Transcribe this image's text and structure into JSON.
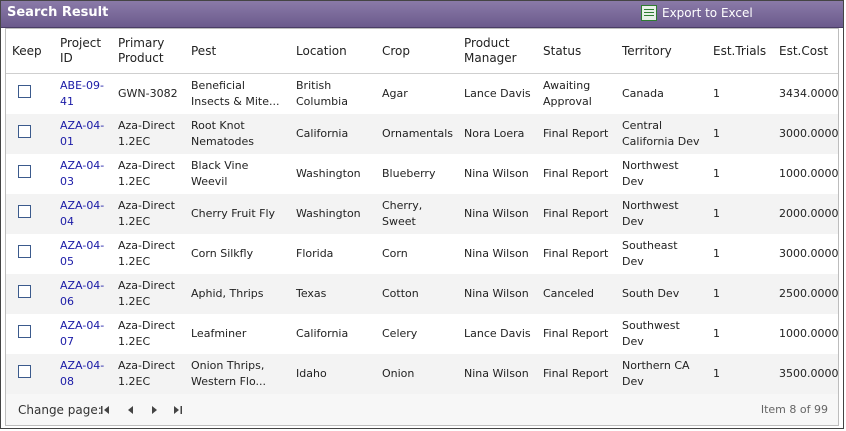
{
  "window": {
    "title": "Search Result",
    "export_label": "Export to Excel"
  },
  "columns": [
    "Keep",
    "Project ID",
    "Primary Product",
    "Pest",
    "Location",
    "Crop",
    "Product Manager",
    "Status",
    "Territory",
    "Est.Trials",
    "Est.Cost"
  ],
  "rows": [
    {
      "project_id": "ABE-09-41",
      "product": "GWN-3082",
      "pest": "Beneficial Insects & Mite...",
      "location": "British Columbia",
      "crop": "Agar",
      "manager": "Lance Davis",
      "status": "Awaiting Approval",
      "territory": "Canada",
      "trials": "1",
      "cost": "3434.0000"
    },
    {
      "project_id": "AZA-04-01",
      "product": "Aza-Direct 1.2EC",
      "pest": "Root Knot Nematodes",
      "location": "California",
      "crop": "Ornamentals",
      "manager": "Nora Loera",
      "status": "Final Report",
      "territory": "Central California Dev",
      "trials": "1",
      "cost": "3000.0000"
    },
    {
      "project_id": "AZA-04-03",
      "product": "Aza-Direct 1.2EC",
      "pest": "Black Vine Weevil",
      "location": "Washington",
      "crop": "Blueberry",
      "manager": "Nina Wilson",
      "status": "Final Report",
      "territory": "Northwest Dev",
      "trials": "1",
      "cost": "1000.0000"
    },
    {
      "project_id": "AZA-04-04",
      "product": "Aza-Direct 1.2EC",
      "pest": "Cherry Fruit Fly",
      "location": "Washington",
      "crop": "Cherry, Sweet",
      "manager": "Nina Wilson",
      "status": "Final Report",
      "territory": "Northwest Dev",
      "trials": "1",
      "cost": "2000.0000"
    },
    {
      "project_id": "AZA-04-05",
      "product": "Aza-Direct 1.2EC",
      "pest": "Corn Silkfly",
      "location": "Florida",
      "crop": "Corn",
      "manager": "Nina Wilson",
      "status": "Final Report",
      "territory": "Southeast Dev",
      "trials": "1",
      "cost": "3000.0000"
    },
    {
      "project_id": "AZA-04-06",
      "product": "Aza-Direct 1.2EC",
      "pest": "Aphid, Thrips",
      "location": "Texas",
      "crop": "Cotton",
      "manager": "Nina Wilson",
      "status": "Canceled",
      "territory": "South Dev",
      "trials": "1",
      "cost": "2500.0000"
    },
    {
      "project_id": "AZA-04-07",
      "product": "Aza-Direct 1.2EC",
      "pest": "Leafminer",
      "location": "California",
      "crop": "Celery",
      "manager": "Lance Davis",
      "status": "Final Report",
      "territory": "Southwest Dev",
      "trials": "1",
      "cost": "1000.0000"
    },
    {
      "project_id": "AZA-04-08",
      "product": "Aza-Direct 1.2EC",
      "pest": "Onion Thrips, Western Flo...",
      "location": "Idaho",
      "crop": "Onion",
      "manager": "Nina Wilson",
      "status": "Final Report",
      "territory": "Northern CA Dev",
      "trials": "1",
      "cost": "3500.0000"
    }
  ],
  "pager": {
    "label": "Change page:",
    "item_info": "Item 8 of 99"
  }
}
